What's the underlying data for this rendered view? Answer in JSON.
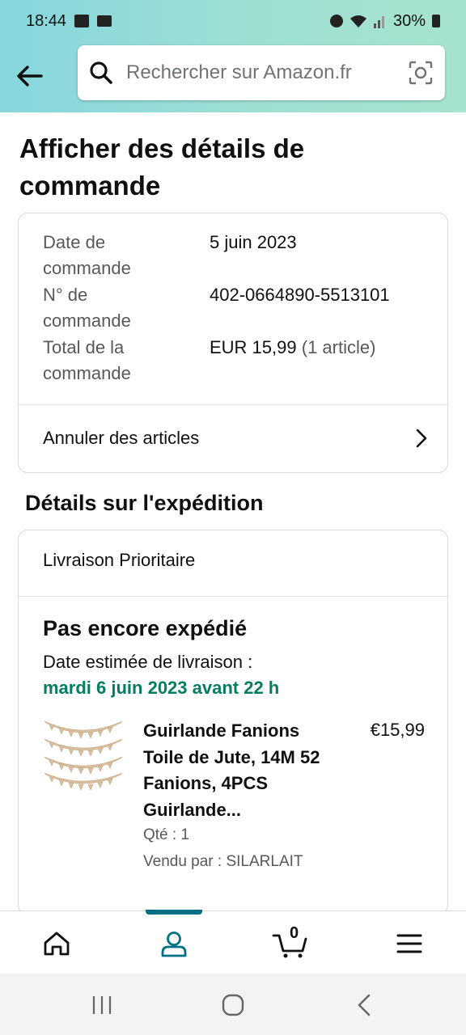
{
  "status_bar": {
    "time": "18:44",
    "battery": "30%"
  },
  "header": {
    "search": {
      "placeholder": "Rechercher sur Amazon.fr"
    }
  },
  "page": {
    "title": "Afficher des détails de commande"
  },
  "order": {
    "date_label": "Date de commande",
    "date_value": "5 juin 2023",
    "number_label": "N° de commande",
    "number_value": "402-0664890-5513101",
    "total_label": "Total de la commande",
    "total_value": "EUR 15,99",
    "total_items": "(1 article)",
    "cancel_label": "Annuler des articles"
  },
  "shipping": {
    "section_title": "Détails sur l'expédition",
    "delivery_type": "Livraison Prioritaire",
    "status": "Pas encore expédié",
    "estimate_label": "Date estimée de livraison :",
    "estimate_date": "mardi 6 juin 2023 avant 22 h",
    "estimate_color": "#067d62",
    "item": {
      "name": "Guirlande Fanions Toile de Jute, 14M 52 Fanions, 4PCS Guirlande...",
      "price": "€15,99",
      "qty": "Qté : 1",
      "seller": "Vendu par : SILARLAIT"
    }
  },
  "bottom_nav": {
    "items": [
      "home-icon",
      "account-icon",
      "cart-icon",
      "menu-icon"
    ],
    "active": "account-icon",
    "cart_count": "0",
    "accent": "#007185"
  },
  "system_nav": {
    "items": [
      "recents-icon",
      "home-circle-icon",
      "back-chevron-icon"
    ]
  }
}
